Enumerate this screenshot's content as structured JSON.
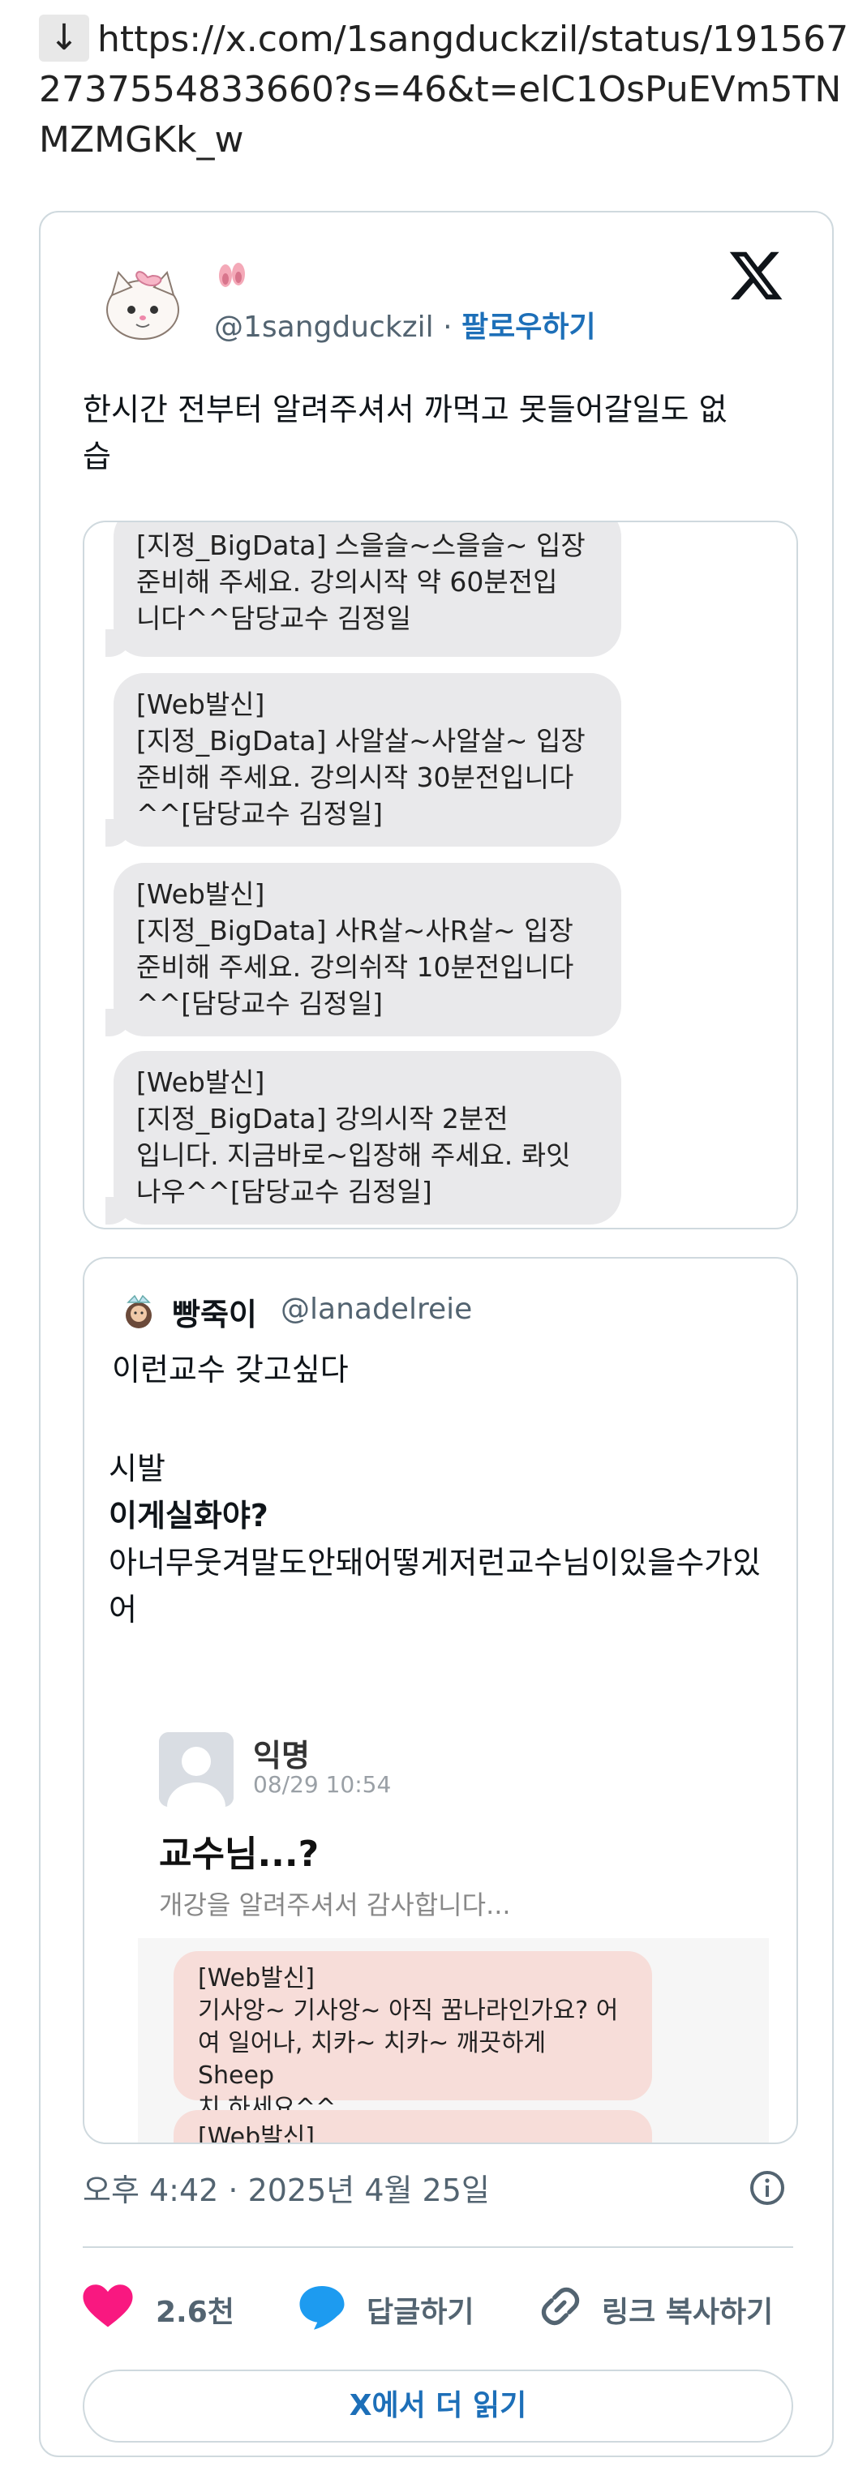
{
  "top_link": {
    "arrow": "↓",
    "url": "https://x.com/1sangduckzil/status/1915672737554833660?s=46&t=elC1OsPuEVm5TNMZMGKk_w"
  },
  "tweet": {
    "display_name_icon": "ballet-shoes-emoji",
    "handle": "@1sangduckzil",
    "separator": "·",
    "follow_label": "팔로우하기",
    "text": "한시간 전부터 알려주셔서 까먹고 못들어갈일도 없습",
    "text_line2": "습",
    "media_bubbles": [
      {
        "lines": [
          "[지정_BigData] 스을슬~스을슬~ 입장",
          "준비해 주세요. 강의시작 약 60분전입",
          "니다^^담당교수 김정일"
        ]
      },
      {
        "lines": [
          "[Web발신]",
          "[지정_BigData] 사알살~사알살~ 입장",
          "준비해 주세요. 강의시작 30분전입니다",
          "^^[담당교수 김정일]"
        ]
      },
      {
        "lines": [
          "[Web발신]",
          "[지정_BigData] 사R살~사R살~ 입장",
          "준비해 주세요. 강의쉬작 10분전입니다",
          "^^[담당교수 김정일]"
        ]
      },
      {
        "lines": [
          "[Web발신]",
          "[지정_BigData] 강의시작 2분전",
          "입니다. 지금바로~입장해 주세요. 롸잇",
          "나우^^[담당교수 김정일]"
        ]
      }
    ]
  },
  "quote": {
    "name": "빵죽이",
    "handle": "@lanadelreie",
    "line1": "이런교수 갖고싶다",
    "line2": "시발",
    "line3": "이게실화야?",
    "line4": "아너무웃겨말도안돼어떻게저런교수님이있을수가있",
    "line5": "어",
    "inner": {
      "author": "익명",
      "time": "08/29 10:54",
      "title": "교수님...?",
      "subtitle": "개강을 알려주셔서 감사합니다...",
      "bubble1": [
        "[Web발신]",
        "기사앙~ 기사앙~ 아직 꿈나라인가요? 어",
        "여 일어나, 치카~ 치카~ 깨끗하게 Sheep",
        "치 하세요^^"
      ],
      "bubble2": [
        "[Web발신]"
      ]
    }
  },
  "meta": {
    "timestamp": "오후 4:42 · 2025년 4월 25일"
  },
  "actions": {
    "like_count": "2.6천",
    "reply_label": "답글하기",
    "copy_link_label": "링크 복사하기"
  },
  "read_more": "X에서 더 읽기",
  "colors": {
    "link_blue": "#1d6fb8",
    "like_pink": "#f91880",
    "reply_blue": "#1d9bf0",
    "bubble_gray": "#e9e9eb",
    "bubble_pink": "#f7ddd9"
  }
}
